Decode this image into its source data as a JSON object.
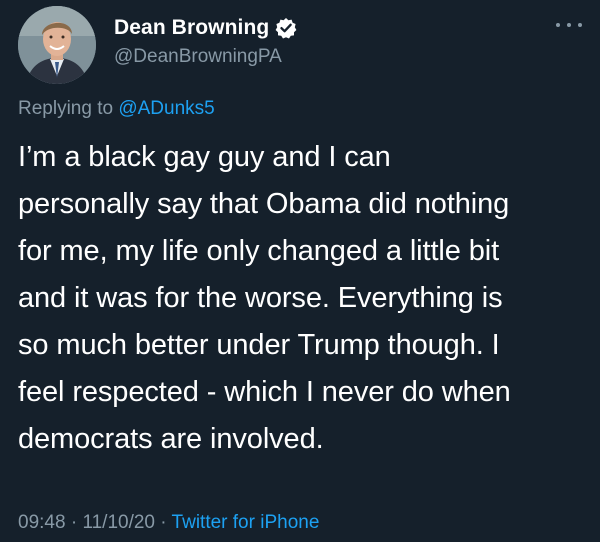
{
  "author": {
    "display_name": "Dean Browning",
    "handle": "@DeanBrowningPA",
    "verified": true,
    "avatar_icon": "profile-photo"
  },
  "reply": {
    "prefix": "Replying to ",
    "mention": "@ADunks5"
  },
  "tweet": {
    "lines": [
      "I’m a black gay guy and I can",
      "personally say that Obama did nothing",
      "for me, my life only changed a little bit",
      "and it was for the worse. Everything is",
      "so much better under Trump though. I",
      "feel respected - which I never do when",
      "democrats are involved."
    ]
  },
  "meta": {
    "time": "09:48",
    "separator1": " · ",
    "date": "11/10/20",
    "separator2": " · ",
    "source": "Twitter for iPhone"
  },
  "colors": {
    "background": "#15202b",
    "primary_text": "#ffffff",
    "secondary_text": "#8899a6",
    "accent": "#1da1f2"
  }
}
